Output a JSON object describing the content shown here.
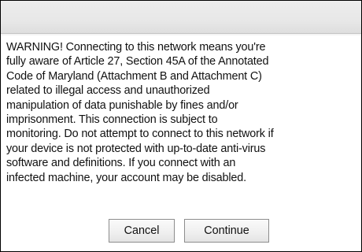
{
  "dialog": {
    "title": "",
    "message_lines": [
      "WARNING! Connecting to this network means you're",
      "fully aware of Article 27, Section 45A of the Annotated",
      "Code of Maryland (Attachment B and Attachment C)",
      "related to illegal access and unauthorized",
      "manipulation of data punishable by fines and/or",
      "imprisonment. This connection is subject to",
      "monitoring. Do not attempt to connect to this network if",
      "your device is not protected with up-to-date anti-virus",
      "software and definitions. If you connect with an",
      "infected machine, your account may be disabled."
    ],
    "buttons": {
      "cancel_label": "Cancel",
      "continue_label": "Continue"
    }
  },
  "colors": {
    "border": "#000000",
    "title_bar": "#e8e8e8",
    "text": "#111111",
    "button_border": "#8d8d8d"
  }
}
